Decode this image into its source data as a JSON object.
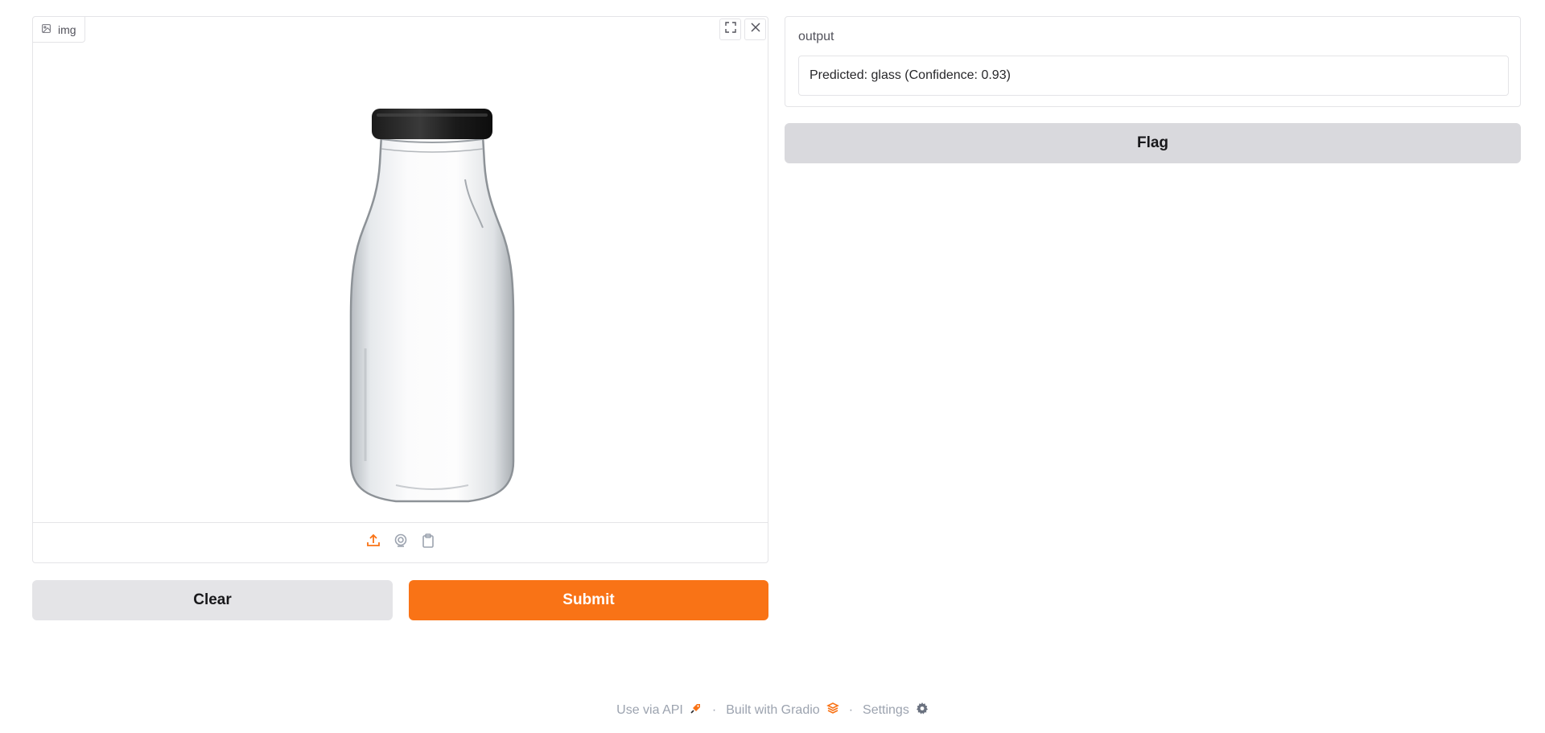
{
  "input": {
    "label": "img"
  },
  "output": {
    "label": "output",
    "value": "Predicted: glass (Confidence: 0.93)"
  },
  "buttons": {
    "clear": "Clear",
    "submit": "Submit",
    "flag": "Flag"
  },
  "footer": {
    "api": "Use via API",
    "built": "Built with Gradio",
    "settings": "Settings",
    "separator": "·"
  },
  "colors": {
    "accent": "#f97316",
    "secondary_button": "#e4e4e7"
  },
  "icons": {
    "input_label": "image-icon",
    "fullscreen": "fullscreen-icon",
    "clear_image": "close-icon",
    "upload": "upload-icon",
    "webcam": "webcam-icon",
    "clipboard": "clipboard-icon",
    "api": "rocket-icon",
    "gradio": "gradio-logo-icon",
    "settings": "gear-icon"
  }
}
